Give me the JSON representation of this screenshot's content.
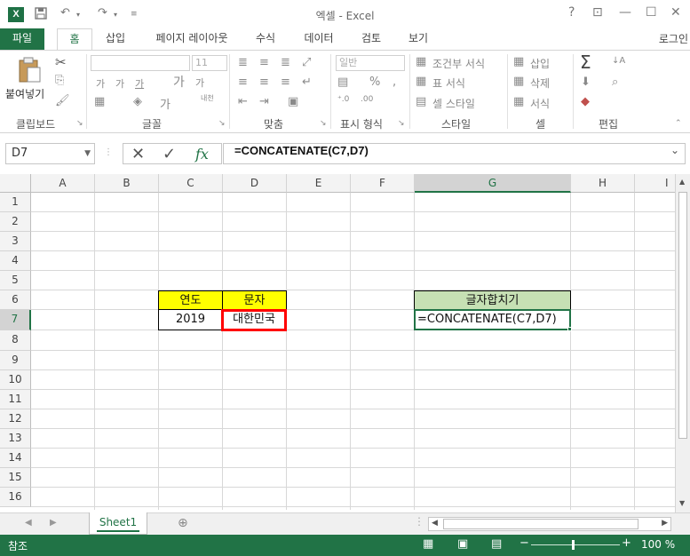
{
  "app": {
    "title": "엑셀 - Excel",
    "logo_text": "X",
    "accent_color": "#217346"
  },
  "quick_access": {
    "save_icon": "save-icon",
    "undo_icon": "undo-icon",
    "redo_icon": "redo-icon",
    "customize_icon": "customize-icon"
  },
  "window_controls": {
    "help": "?",
    "restore_ribbon": "⊡",
    "minimize": "—",
    "maximize": "☐",
    "close": "✕"
  },
  "tabs": [
    {
      "label": "파일"
    },
    {
      "label": "홈"
    },
    {
      "label": "삽입"
    },
    {
      "label": "페이지 레이아웃"
    },
    {
      "label": "수식"
    },
    {
      "label": "데이터"
    },
    {
      "label": "검토"
    },
    {
      "label": "보기"
    }
  ],
  "login_label": "로그인",
  "ribbon": {
    "paste_label": "붙여넣기",
    "font_size": "11",
    "number_format": "일반",
    "conditional_format": "조건부 서식",
    "format_table": "표 서식",
    "cell_style": "셀 스타일",
    "insert": "삽입",
    "delete": "삭제",
    "format": "서식",
    "wrap_label": "내어",
    "groups": [
      "클립보드",
      "글꼴",
      "맞춤",
      "표시 형식",
      "스타일",
      "셀",
      "편집"
    ]
  },
  "formula_bar": {
    "name_box": "D7",
    "fx": "fx",
    "formula": "=CONCATENATE(C7,D7)"
  },
  "columns": [
    "A",
    "B",
    "C",
    "D",
    "E",
    "F",
    "G",
    "H",
    "I"
  ],
  "rows": [
    "1",
    "2",
    "3",
    "4",
    "5",
    "6",
    "7",
    "8",
    "9",
    "10",
    "11",
    "12",
    "13",
    "14",
    "15",
    "16"
  ],
  "cells": {
    "C6": "연도",
    "D6": "문자",
    "C7": "2019",
    "D7": "대한민국",
    "G6": "글자합치기",
    "G7": "=CONCATENATE(C7,D7)"
  },
  "colors": {
    "header_yellow": "#ffff00",
    "header_green": "#c6e0b4",
    "highlight_red": "#ff0000"
  },
  "sheet_tabs": [
    "Sheet1"
  ],
  "status": {
    "mode": "참조",
    "zoom": "100 %"
  }
}
